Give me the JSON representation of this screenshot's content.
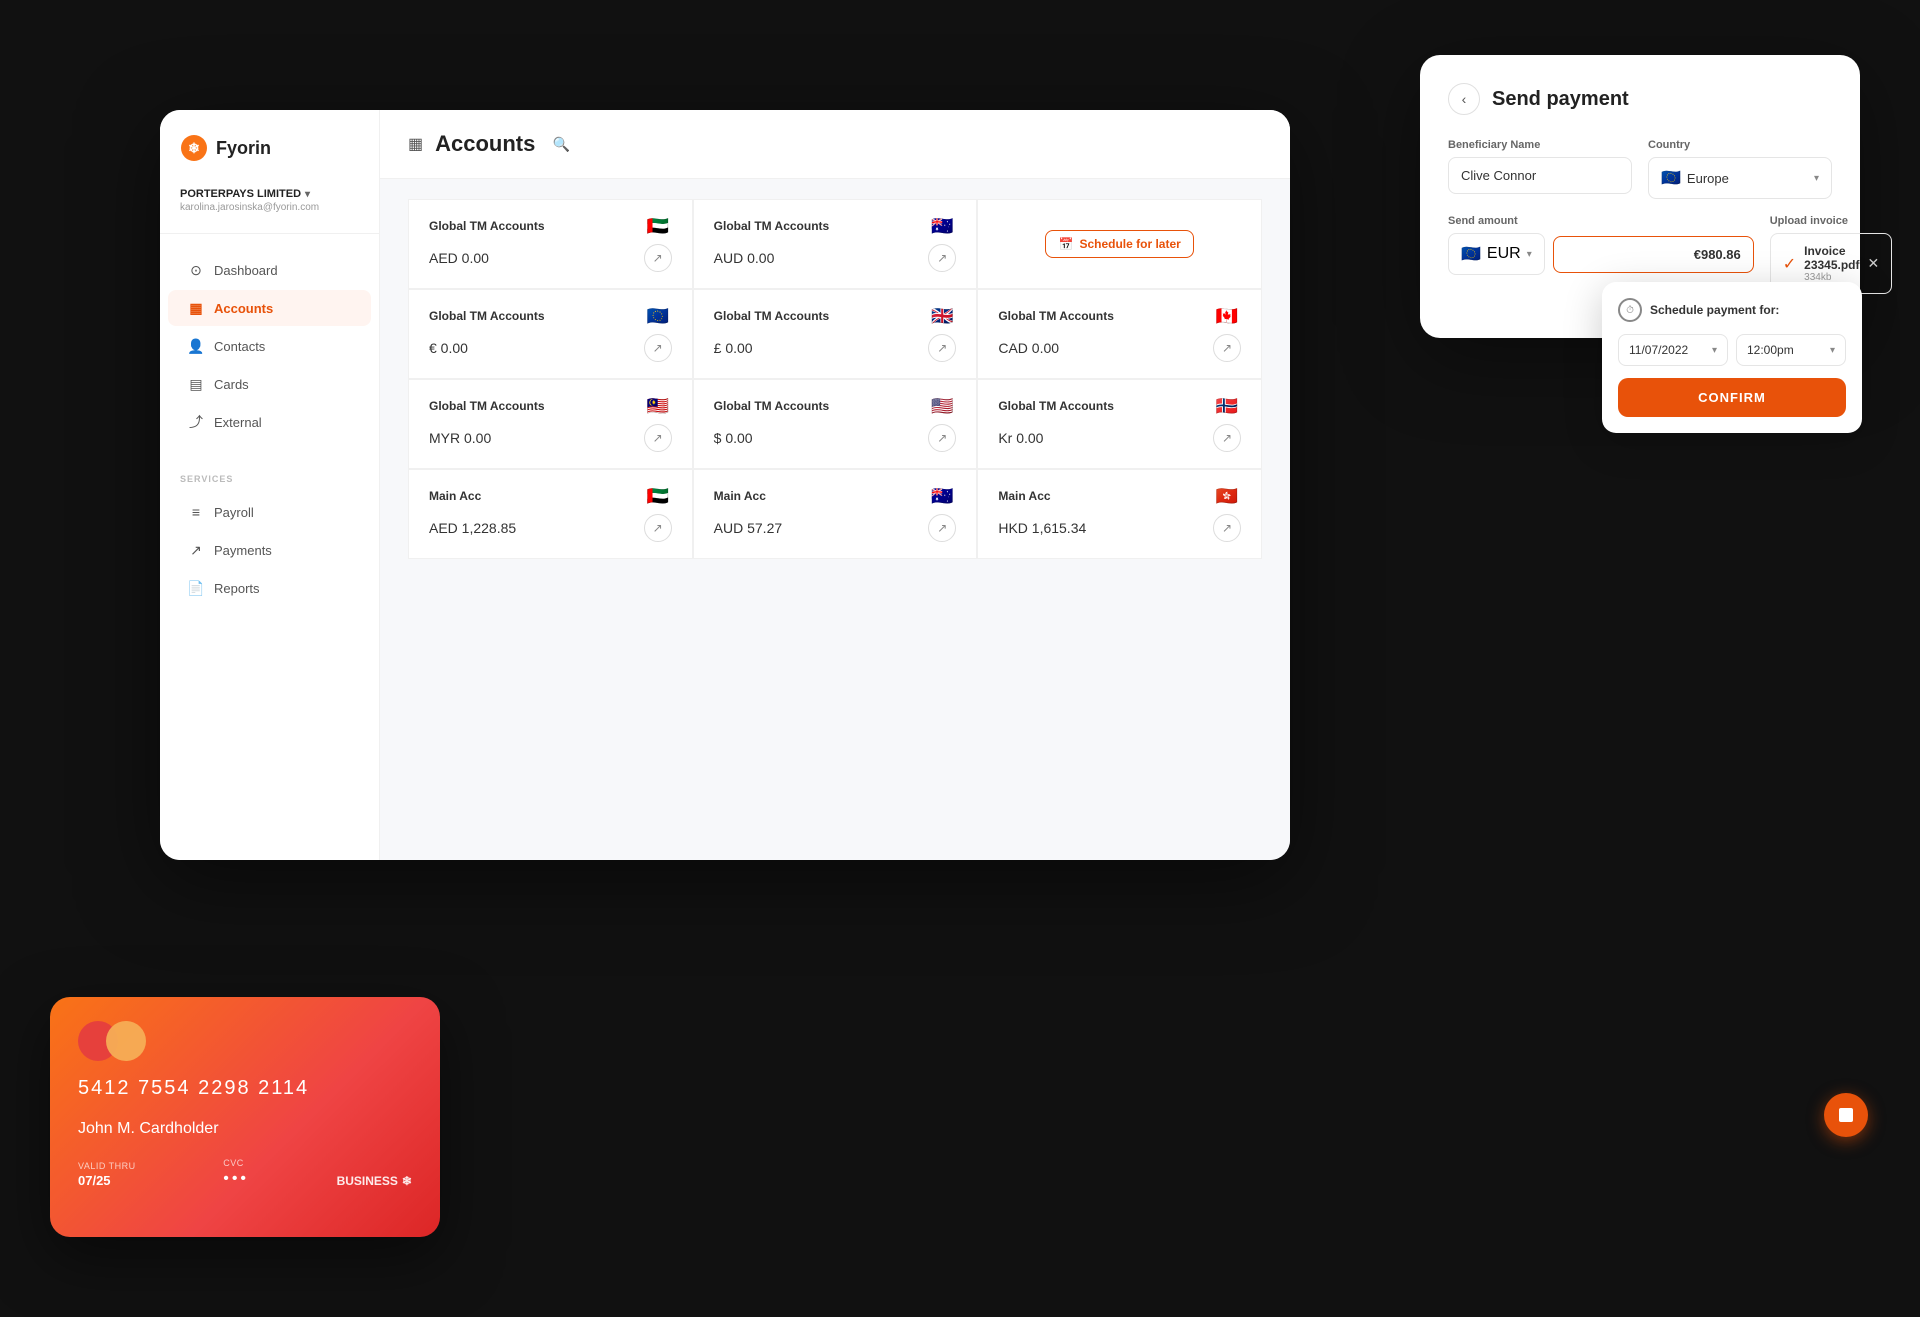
{
  "app": {
    "logo_text": "Fyorin",
    "company_name": "PORTERPAYS LIMITED",
    "user_email": "karolina.jarosinska@fyorin.com"
  },
  "sidebar": {
    "nav_items": [
      {
        "id": "dashboard",
        "label": "Dashboard",
        "icon": "⊙",
        "active": false
      },
      {
        "id": "accounts",
        "label": "Accounts",
        "icon": "▦",
        "active": true
      },
      {
        "id": "contacts",
        "label": "Contacts",
        "icon": "👤",
        "active": false
      },
      {
        "id": "cards",
        "label": "Cards",
        "icon": "▤",
        "active": false
      },
      {
        "id": "external",
        "label": "External",
        "icon": "⤴",
        "active": false
      }
    ],
    "services_label": "SERVICES",
    "service_items": [
      {
        "id": "payroll",
        "label": "Payroll",
        "icon": "≡"
      },
      {
        "id": "payments",
        "label": "Payments",
        "icon": "↗"
      },
      {
        "id": "reports",
        "label": "Reports",
        "icon": "📄"
      }
    ]
  },
  "header": {
    "title": "Accounts",
    "title_icon": "▦"
  },
  "accounts": [
    {
      "name": "Global TM Accounts",
      "flag": "🇦🇪",
      "balance": "AED 0.00"
    },
    {
      "name": "Global TM Accounts",
      "flag": "🇦🇺",
      "balance": "AUD 0.00"
    },
    {
      "name": "schedule_later",
      "flag": "",
      "balance": ""
    },
    {
      "name": "Global TM Accounts",
      "flag": "🇪🇺",
      "balance": "€ 0.00"
    },
    {
      "name": "Global TM Accounts",
      "flag": "🇬🇧",
      "balance": "£ 0.00"
    },
    {
      "name": "Global TM Accounts",
      "flag": "🇨🇦",
      "balance": "CAD 0.00"
    },
    {
      "name": "Global TM Accounts",
      "flag": "🇲🇾",
      "balance": "MYR 0.00"
    },
    {
      "name": "Global TM Accounts",
      "flag": "🇺🇸",
      "balance": "$ 0.00"
    },
    {
      "name": "Global TM Accounts",
      "flag": "🇳🇴",
      "balance": "Kr 0.00"
    },
    {
      "name": "Main Acc",
      "flag": "🇦🇪",
      "balance": "AED 1,228.85"
    },
    {
      "name": "Main Acc",
      "flag": "🇦🇺",
      "balance": "AUD 57.27"
    },
    {
      "name": "Main Acc",
      "flag": "🇭🇰",
      "balance": "HKD 1,615.34"
    }
  ],
  "send_payment": {
    "title": "Send payment",
    "beneficiary_label": "Beneficiary Name",
    "beneficiary_value": "Clive Connor",
    "country_label": "Country",
    "country_value": "Europe",
    "send_amount_label": "Send amount",
    "currency": "EUR",
    "amount": "€980.86",
    "upload_invoice_label": "Upload invoice",
    "invoice_name": "Invoice 23345.pdf",
    "invoice_size": "334kb",
    "schedule_later_label": "Schedule for later"
  },
  "schedule_popup": {
    "title": "Schedule payment for:",
    "date_value": "11/07/2022",
    "time_value": "12:00pm",
    "confirm_label": "CONFIRM"
  },
  "credit_card": {
    "number": "5412  7554  2298  2114",
    "holder": "John M. Cardholder",
    "valid_thru_label": "VALID THRU",
    "valid_thru_value": "07/25",
    "cvc_label": "CVC",
    "cvc_value": "•••",
    "brand": "BUSINESS"
  }
}
